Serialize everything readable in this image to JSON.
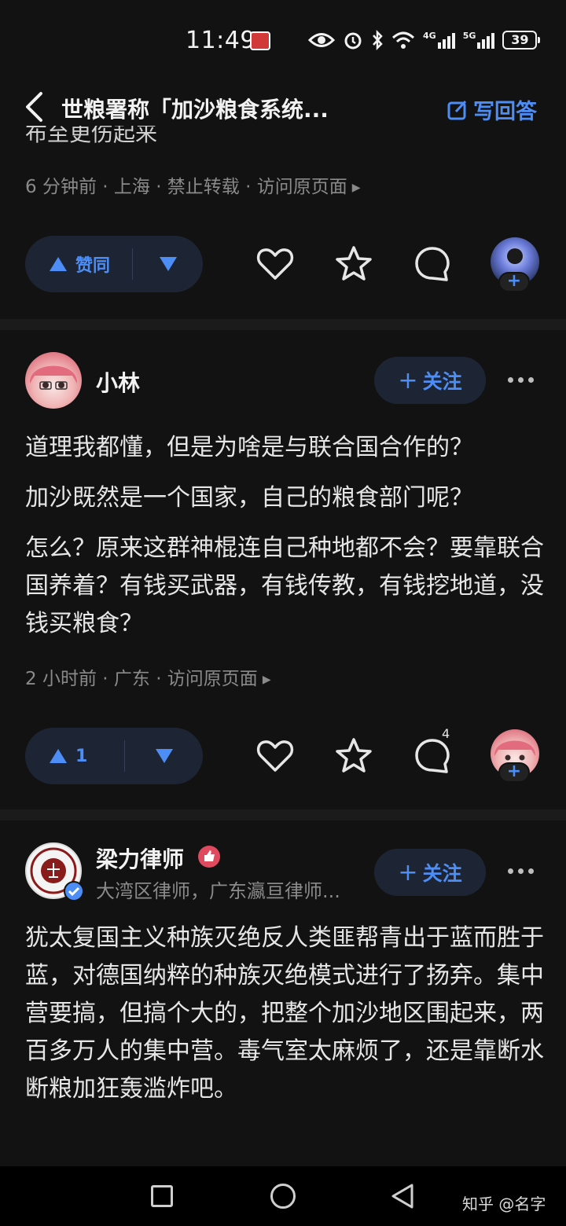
{
  "status_bar": {
    "time": "11:49",
    "network_1": "4G",
    "network_2": "5G",
    "battery": "39"
  },
  "header": {
    "title": "世粮署称「加沙粮食系统...",
    "write_answer": "写回答"
  },
  "prev_answer": {
    "peek_text": "布至更伤起来",
    "meta": "6 分钟前 · 上海 · 禁止转载 · 访问原页面",
    "vote_label": "赞同"
  },
  "answer1": {
    "author": "小林",
    "follow": "关注",
    "paragraphs": [
      "道理我都懂，但是为啥是与联合国合作的？",
      "加沙既然是一个国家，自己的粮食部门呢？",
      "怎么？原来这群神棍连自己种地都不会？要靠联合国养着？有钱买武器，有钱传教，有钱挖地道，没钱买粮食？"
    ],
    "meta": "2 小时前 · 广东 · 访问原页面",
    "vote_count": "1",
    "comment_count": "4"
  },
  "answer2": {
    "author": "梁力律师",
    "bio": "大湾区律师，广东瀛亘律师...",
    "follow": "关注",
    "paragraphs": [
      "犹太复国主义种族灭绝反人类匪帮青出于蓝而胜于蓝，对德国纳粹的种族灭绝模式进行了扬弃。集中营要搞，但搞个大的，把整个加沙地区围起来，两百多万人的集中营。毒气室太麻烦了，还是靠断水断粮加狂轰滥炸吧。"
    ]
  },
  "watermark": "知乎 @名字",
  "colors": {
    "accent": "#4d8df6",
    "background": "#121212",
    "pill": "#1d2535"
  }
}
